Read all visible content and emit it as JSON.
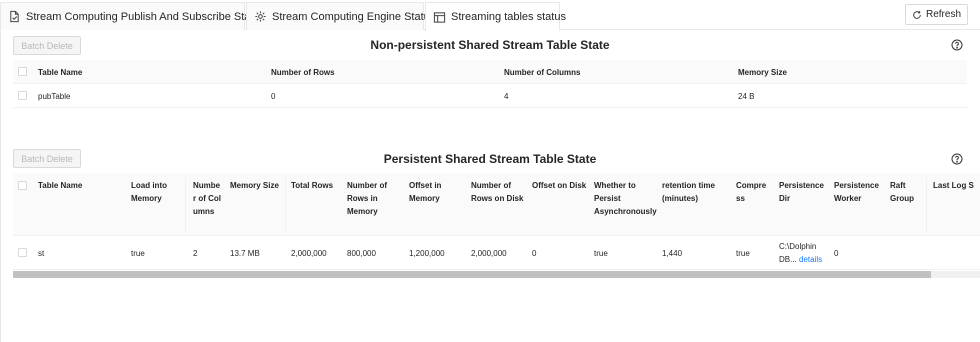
{
  "tabs": [
    {
      "label": "Stream Computing Publish And Subscribe Status",
      "icon": "document-check-icon",
      "active": false
    },
    {
      "label": "Stream Computing Engine Status",
      "icon": "engine-icon",
      "active": false
    },
    {
      "label": "Streaming tables status",
      "icon": "table-icon",
      "active": true
    }
  ],
  "refresh_label": "Refresh",
  "non_persistent": {
    "batch_delete_label": "Batch Delete",
    "title": "Non-persistent Shared Stream Table State",
    "columns": [
      "Table Name",
      "Number of Rows",
      "Number of Columns",
      "Memory Size"
    ],
    "rows": [
      {
        "table_name": "pubTable",
        "rows": "0",
        "columns": "4",
        "memory_size": "24 B"
      }
    ]
  },
  "persistent": {
    "batch_delete_label": "Batch Delete",
    "title": "Persistent Shared Stream Table State",
    "columns": {
      "table_name": "Table Name",
      "load_into_memory": "Load into Memory",
      "number_of_columns": "Number of Columns",
      "memory_size": "Memory Size",
      "total_rows": "Total Rows",
      "rows_in_memory": "Number of Rows in Memory",
      "offset_in_memory": "Offset in Memory",
      "rows_on_disk": "Number of Rows on Disk",
      "offset_on_disk": "Offset on Disk",
      "persist_async": "Whether to Persist Asynchronously",
      "retention_time": "retention time (minutes)",
      "compress": "Compress",
      "persistence_dir": "Persistence Dir",
      "persistence_worker": "Persistence Worker",
      "raft_group": "Raft Group",
      "last_log": "Last Log S"
    },
    "rows": [
      {
        "table_name": "st",
        "load_into_memory": "true",
        "number_of_columns": "2",
        "memory_size": "13.7 MB",
        "total_rows": "2,000,000",
        "rows_in_memory": "800,000",
        "offset_in_memory": "1,200,000",
        "rows_on_disk": "2,000,000",
        "offset_on_disk": "0",
        "persist_async": "true",
        "retention_time": "1,440",
        "compress": "true",
        "persistence_dir_line1": "C:\\Dolphin",
        "persistence_dir_line2": "DB...",
        "details_label": "details",
        "persistence_worker": "0",
        "raft_group": "",
        "last_log": ""
      }
    ]
  }
}
